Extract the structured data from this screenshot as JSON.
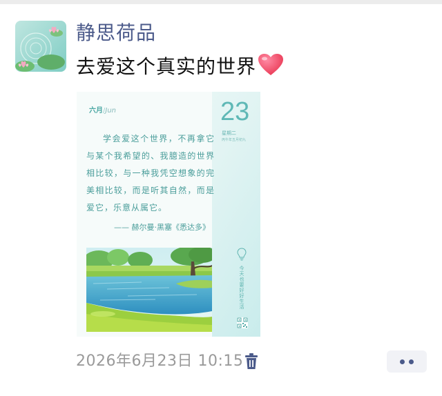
{
  "post": {
    "username": "静思荷品",
    "text": "去爱这个真实的世界",
    "timestamp": "2026年6月23日 10:15"
  },
  "card": {
    "month_cn": "六月",
    "month_en": "Jun",
    "day": "23",
    "weekday": "星期二",
    "lunar": "丙午年五月初九",
    "quote": "学会爱这个世界，不再拿它与某个我希望的、我臆造的世界相比较，与一种我凭空想象的完美相比较，而是听其自然，而是爱它，乐意从属它。",
    "author": "—— 赫尔曼·黑塞《悉达多》",
    "side_text": "今天也要好好生活"
  },
  "icons": {
    "heart": "heart-emoji-icon",
    "trash": "trash-icon",
    "more": "more-dots-icon",
    "bulb": "lightbulb-icon",
    "qr": "qr-code-icon"
  },
  "colors": {
    "username": "#4b5a8a",
    "timestamp": "#9a9a9a",
    "card_accent": "#5fb8b6"
  }
}
